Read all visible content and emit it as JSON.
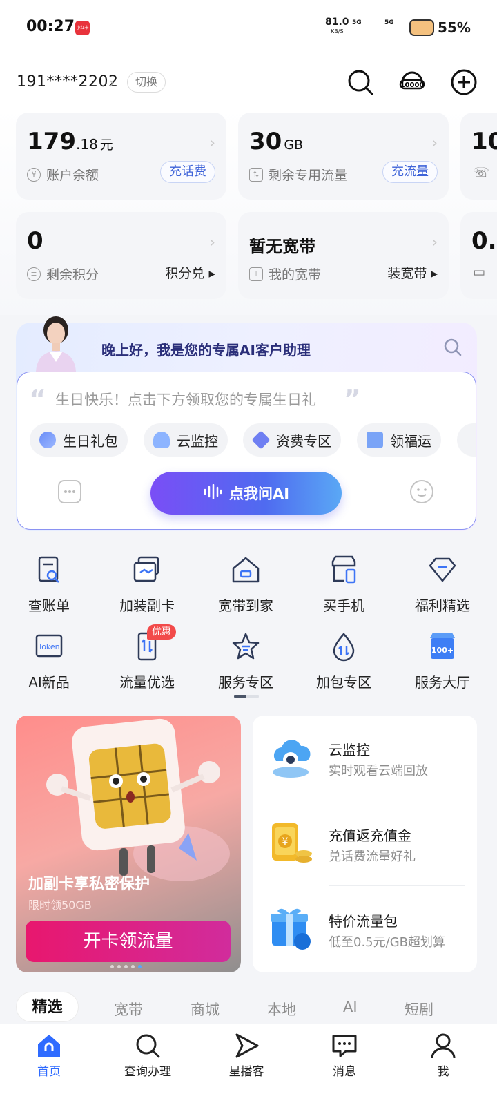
{
  "status_bar": {
    "time": "00:27",
    "app_badge": "小红书",
    "net_speed": "81.0",
    "net_unit": "KB/S",
    "sig1": "5G",
    "sig2": "5G",
    "battery": "55%"
  },
  "header": {
    "phone": "191****2202",
    "switch_label": "切换"
  },
  "cards": [
    {
      "value_int": "179",
      "value_dec": ".18",
      "unit": "元",
      "label": "账户余额",
      "action": "充话费",
      "icon": "yuan-icon"
    },
    {
      "value_int": "30",
      "value_dec": "",
      "unit": "GB",
      "label": "剩余专用流量",
      "action": "充流量",
      "icon": "data-icon"
    },
    {
      "value_int": "10",
      "label": "",
      "icon": "phone-icon"
    },
    {
      "value_int": "0",
      "value_dec": "",
      "unit": "",
      "label": "剩余积分",
      "action": "积分兑",
      "icon": "points-icon"
    },
    {
      "value_text": "暂无宽带",
      "label": "我的宽带",
      "action": "装宽带",
      "icon": "router-icon"
    },
    {
      "value_int": "0.",
      "label": "",
      "icon": "wallet-icon"
    }
  ],
  "ai": {
    "greeting": "晚上好，我是您的专属AI客户助理",
    "prompt": "生日快乐！点击下方领取您的专属生日礼",
    "chips": [
      "生日礼包",
      "云监控",
      "资费专区",
      "领福运"
    ],
    "ask_label": "点我问AI"
  },
  "grid": [
    {
      "label": "查账单",
      "icon": "bill-icon"
    },
    {
      "label": "加装副卡",
      "icon": "sim-card-icon"
    },
    {
      "label": "宽带到家",
      "icon": "home-broadband-icon"
    },
    {
      "label": "买手机",
      "icon": "phone-store-icon"
    },
    {
      "label": "福利精选",
      "icon": "diamond-icon"
    },
    {
      "label": "AI新品",
      "icon": "token-icon"
    },
    {
      "label": "流量优选",
      "icon": "data-phone-icon"
    },
    {
      "label": "服务专区",
      "icon": "star-icon"
    },
    {
      "label": "加包专区",
      "icon": "drop-icon"
    },
    {
      "label": "服务大厅",
      "icon": "hall-icon"
    }
  ],
  "grid_badge": "优惠",
  "promo": {
    "title": "加副卡享私密保护",
    "subtitle": "限时领50GB",
    "button": "开卡领流量"
  },
  "promo_list": [
    {
      "title": "云监控",
      "subtitle": "实时观看云端回放",
      "icon": "cloud-camera-icon"
    },
    {
      "title": "充值返充值金",
      "subtitle": "兑话费流量好礼",
      "icon": "gold-phone-icon"
    },
    {
      "title": "特价流量包",
      "subtitle": "低至0.5元/GB超划算",
      "icon": "gift-box-icon"
    }
  ],
  "tabs": [
    "精选",
    "宽带",
    "商城",
    "本地",
    "AI",
    "短剧"
  ],
  "nav": [
    {
      "label": "首页",
      "icon": "home-icon"
    },
    {
      "label": "查询办理",
      "icon": "search-icon"
    },
    {
      "label": "星播客",
      "icon": "play-icon"
    },
    {
      "label": "消息",
      "icon": "message-icon"
    },
    {
      "label": "我",
      "icon": "user-icon"
    }
  ],
  "colors": {
    "accent": "#2f6bff",
    "ai_button_start": "#7a4ef6",
    "ai_button_end": "#5aa8f5",
    "promo_button": "#e8176e",
    "badge": "#f24a4a"
  }
}
